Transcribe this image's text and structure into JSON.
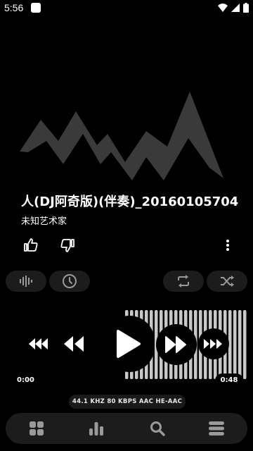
{
  "status_bar": {
    "time": "5:56"
  },
  "track": {
    "title": "人(DJ阿奇版)(伴奏)_20160105704",
    "artist": "未知艺术家"
  },
  "playback": {
    "elapsed": "0:00",
    "duration": "0:48",
    "progress": 0.0
  },
  "audio_info": "44.1 KHZ  80 KBPS  AAC HE-AAC",
  "icons": {
    "like": "thumbs-up-icon",
    "dislike": "thumbs-down-icon",
    "more": "more-vertical-icon",
    "waveform": "waveform-icon",
    "timer": "clock-icon",
    "repeat": "repeat-icon",
    "shuffle": "shuffle-icon",
    "seek_back": "fast-rewind-icon",
    "previous": "previous-icon",
    "play": "play-icon",
    "next": "next-icon",
    "seek_forward": "fast-forward-icon",
    "nav": [
      "grid-icon",
      "bar-chart-icon",
      "search-icon",
      "menu-icon"
    ]
  }
}
